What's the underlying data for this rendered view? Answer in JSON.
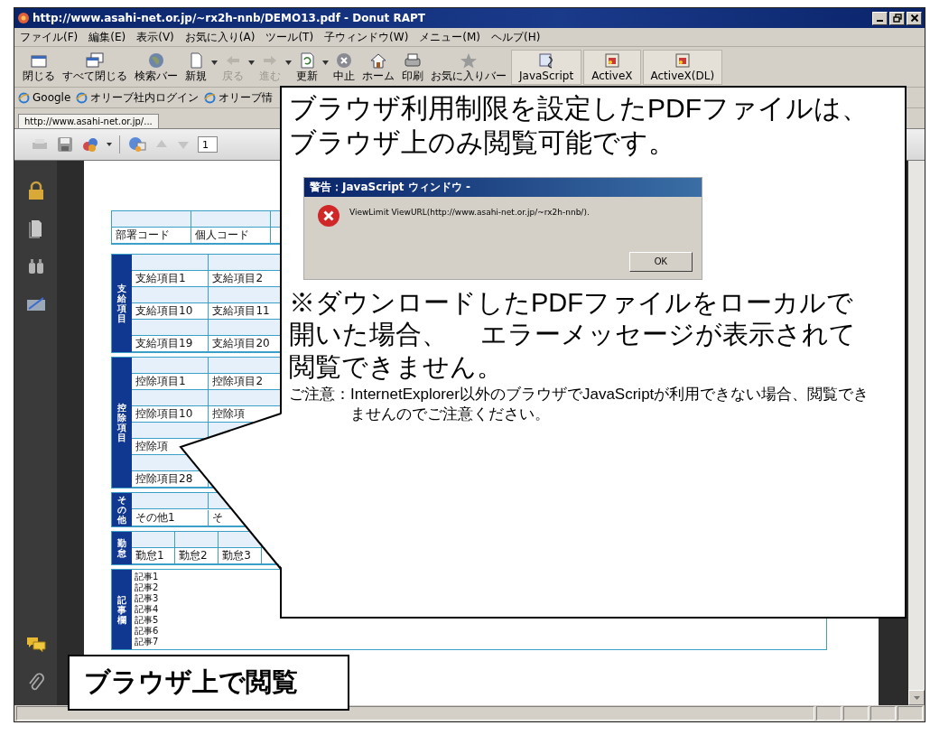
{
  "window": {
    "title": "http://www.asahi-net.or.jp/~rx2h-nnb/DEMO13.pdf - Donut RAPT"
  },
  "menu": [
    "ファイル(F)",
    "編集(E)",
    "表示(V)",
    "お気に入り(A)",
    "ツール(T)",
    "子ウィンドウ(W)",
    "メニュー(M)",
    "ヘルプ(H)"
  ],
  "toolbar": [
    {
      "label": "閉じる",
      "kind": "command",
      "disabled": false,
      "dropdown": false
    },
    {
      "label": "すべて閉じる",
      "kind": "command",
      "disabled": false,
      "dropdown": false
    },
    {
      "label": "検索バー",
      "kind": "command",
      "disabled": false,
      "dropdown": false
    },
    {
      "label": "新規",
      "kind": "command",
      "disabled": false,
      "dropdown": true
    },
    {
      "label": "戻る",
      "kind": "command",
      "disabled": true,
      "dropdown": true
    },
    {
      "label": "進む",
      "kind": "command",
      "disabled": true,
      "dropdown": true
    },
    {
      "label": "更新",
      "kind": "command",
      "disabled": false,
      "dropdown": true
    },
    {
      "label": "中止",
      "kind": "command",
      "disabled": false,
      "dropdown": false
    },
    {
      "label": "ホーム",
      "kind": "command",
      "disabled": false,
      "dropdown": false
    },
    {
      "label": "印刷",
      "kind": "command",
      "disabled": false,
      "dropdown": false
    },
    {
      "label": "お気に入りバー",
      "kind": "command",
      "disabled": false,
      "dropdown": false
    },
    {
      "label": "JavaScript",
      "kind": "plugin",
      "disabled": false,
      "dropdown": false
    },
    {
      "label": "ActiveX",
      "kind": "plugin",
      "disabled": false,
      "dropdown": false
    },
    {
      "label": "ActiveX(DL)",
      "kind": "plugin",
      "disabled": false,
      "dropdown": false
    }
  ],
  "links": [
    "Google",
    "オリーブ社内ログイン",
    "オリーブ情"
  ],
  "tab": {
    "label": "http://www.asahi-net.or.jp/..."
  },
  "pdf_toolbar": {
    "page": "1"
  },
  "pdf_form": {
    "header": [
      "部署コード",
      "個人コード"
    ],
    "sections": [
      {
        "label": "支給項目",
        "kind": "grid",
        "rows": [
          [
            "支給項目1",
            "支給項目2"
          ],
          [
            "支給項目10",
            "支給項目11"
          ],
          [
            "支給項目19",
            "支給項目20"
          ]
        ]
      },
      {
        "label": "控除項目",
        "kind": "grid",
        "rows": [
          [
            "控除項目1",
            "控除項目2"
          ],
          [
            "控除項目10",
            "控除項"
          ],
          [
            "控除項"
          ],
          [
            "控除項目28"
          ]
        ]
      },
      {
        "label": "その他",
        "kind": "grid",
        "rows": [
          [
            "その他1",
            "そ"
          ]
        ]
      },
      {
        "label": "勤怠",
        "kind": "compact",
        "rows": [
          [
            "勤怠1",
            "勤怠2",
            "勤怠3"
          ]
        ]
      },
      {
        "label": "記事欄",
        "kind": "notes",
        "rows": [
          [
            "記事1"
          ],
          [
            "記事2"
          ],
          [
            "記事3"
          ],
          [
            "記事4"
          ],
          [
            "記事5"
          ],
          [
            "記事6"
          ],
          [
            "記事7"
          ]
        ]
      }
    ]
  },
  "callout": {
    "heading": "ブラウザ利用制限を設定したPDFファイルは、ブラウザ上のみ閲覧可能です。",
    "dialog": {
      "title": "警告：JavaScript ウィンドウ -",
      "message": "ViewLimit ViewURL(http://www.asahi-net.or.jp/~rx2h-nnb/).",
      "button": "OK"
    },
    "note": "※ダウンロードしたPDFファイルをローカルで開いた場合、 エラーメッセージが表示されて閲覧できません。",
    "caution_label": "ご注意：",
    "caution": "InternetExplorer以外のブラウザでJavaScriptが利用できない場合、閲覧できませんのでご注意ください。"
  },
  "label_callout": "ブラウザ上で閲覧"
}
